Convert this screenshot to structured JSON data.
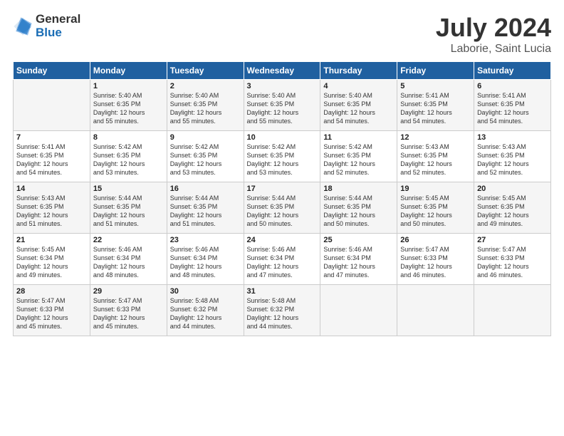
{
  "logo": {
    "general": "General",
    "blue": "Blue"
  },
  "title": "July 2024",
  "location": "Laborie, Saint Lucia",
  "headers": [
    "Sunday",
    "Monday",
    "Tuesday",
    "Wednesday",
    "Thursday",
    "Friday",
    "Saturday"
  ],
  "weeks": [
    [
      {
        "day": "",
        "info": ""
      },
      {
        "day": "1",
        "info": "Sunrise: 5:40 AM\nSunset: 6:35 PM\nDaylight: 12 hours\nand 55 minutes."
      },
      {
        "day": "2",
        "info": "Sunrise: 5:40 AM\nSunset: 6:35 PM\nDaylight: 12 hours\nand 55 minutes."
      },
      {
        "day": "3",
        "info": "Sunrise: 5:40 AM\nSunset: 6:35 PM\nDaylight: 12 hours\nand 55 minutes."
      },
      {
        "day": "4",
        "info": "Sunrise: 5:40 AM\nSunset: 6:35 PM\nDaylight: 12 hours\nand 54 minutes."
      },
      {
        "day": "5",
        "info": "Sunrise: 5:41 AM\nSunset: 6:35 PM\nDaylight: 12 hours\nand 54 minutes."
      },
      {
        "day": "6",
        "info": "Sunrise: 5:41 AM\nSunset: 6:35 PM\nDaylight: 12 hours\nand 54 minutes."
      }
    ],
    [
      {
        "day": "7",
        "info": "Sunrise: 5:41 AM\nSunset: 6:35 PM\nDaylight: 12 hours\nand 54 minutes."
      },
      {
        "day": "8",
        "info": "Sunrise: 5:42 AM\nSunset: 6:35 PM\nDaylight: 12 hours\nand 53 minutes."
      },
      {
        "day": "9",
        "info": "Sunrise: 5:42 AM\nSunset: 6:35 PM\nDaylight: 12 hours\nand 53 minutes."
      },
      {
        "day": "10",
        "info": "Sunrise: 5:42 AM\nSunset: 6:35 PM\nDaylight: 12 hours\nand 53 minutes."
      },
      {
        "day": "11",
        "info": "Sunrise: 5:42 AM\nSunset: 6:35 PM\nDaylight: 12 hours\nand 52 minutes."
      },
      {
        "day": "12",
        "info": "Sunrise: 5:43 AM\nSunset: 6:35 PM\nDaylight: 12 hours\nand 52 minutes."
      },
      {
        "day": "13",
        "info": "Sunrise: 5:43 AM\nSunset: 6:35 PM\nDaylight: 12 hours\nand 52 minutes."
      }
    ],
    [
      {
        "day": "14",
        "info": "Sunrise: 5:43 AM\nSunset: 6:35 PM\nDaylight: 12 hours\nand 51 minutes."
      },
      {
        "day": "15",
        "info": "Sunrise: 5:44 AM\nSunset: 6:35 PM\nDaylight: 12 hours\nand 51 minutes."
      },
      {
        "day": "16",
        "info": "Sunrise: 5:44 AM\nSunset: 6:35 PM\nDaylight: 12 hours\nand 51 minutes."
      },
      {
        "day": "17",
        "info": "Sunrise: 5:44 AM\nSunset: 6:35 PM\nDaylight: 12 hours\nand 50 minutes."
      },
      {
        "day": "18",
        "info": "Sunrise: 5:44 AM\nSunset: 6:35 PM\nDaylight: 12 hours\nand 50 minutes."
      },
      {
        "day": "19",
        "info": "Sunrise: 5:45 AM\nSunset: 6:35 PM\nDaylight: 12 hours\nand 50 minutes."
      },
      {
        "day": "20",
        "info": "Sunrise: 5:45 AM\nSunset: 6:35 PM\nDaylight: 12 hours\nand 49 minutes."
      }
    ],
    [
      {
        "day": "21",
        "info": "Sunrise: 5:45 AM\nSunset: 6:34 PM\nDaylight: 12 hours\nand 49 minutes."
      },
      {
        "day": "22",
        "info": "Sunrise: 5:46 AM\nSunset: 6:34 PM\nDaylight: 12 hours\nand 48 minutes."
      },
      {
        "day": "23",
        "info": "Sunrise: 5:46 AM\nSunset: 6:34 PM\nDaylight: 12 hours\nand 48 minutes."
      },
      {
        "day": "24",
        "info": "Sunrise: 5:46 AM\nSunset: 6:34 PM\nDaylight: 12 hours\nand 47 minutes."
      },
      {
        "day": "25",
        "info": "Sunrise: 5:46 AM\nSunset: 6:34 PM\nDaylight: 12 hours\nand 47 minutes."
      },
      {
        "day": "26",
        "info": "Sunrise: 5:47 AM\nSunset: 6:33 PM\nDaylight: 12 hours\nand 46 minutes."
      },
      {
        "day": "27",
        "info": "Sunrise: 5:47 AM\nSunset: 6:33 PM\nDaylight: 12 hours\nand 46 minutes."
      }
    ],
    [
      {
        "day": "28",
        "info": "Sunrise: 5:47 AM\nSunset: 6:33 PM\nDaylight: 12 hours\nand 45 minutes."
      },
      {
        "day": "29",
        "info": "Sunrise: 5:47 AM\nSunset: 6:33 PM\nDaylight: 12 hours\nand 45 minutes."
      },
      {
        "day": "30",
        "info": "Sunrise: 5:48 AM\nSunset: 6:32 PM\nDaylight: 12 hours\nand 44 minutes."
      },
      {
        "day": "31",
        "info": "Sunrise: 5:48 AM\nSunset: 6:32 PM\nDaylight: 12 hours\nand 44 minutes."
      },
      {
        "day": "",
        "info": ""
      },
      {
        "day": "",
        "info": ""
      },
      {
        "day": "",
        "info": ""
      }
    ]
  ]
}
